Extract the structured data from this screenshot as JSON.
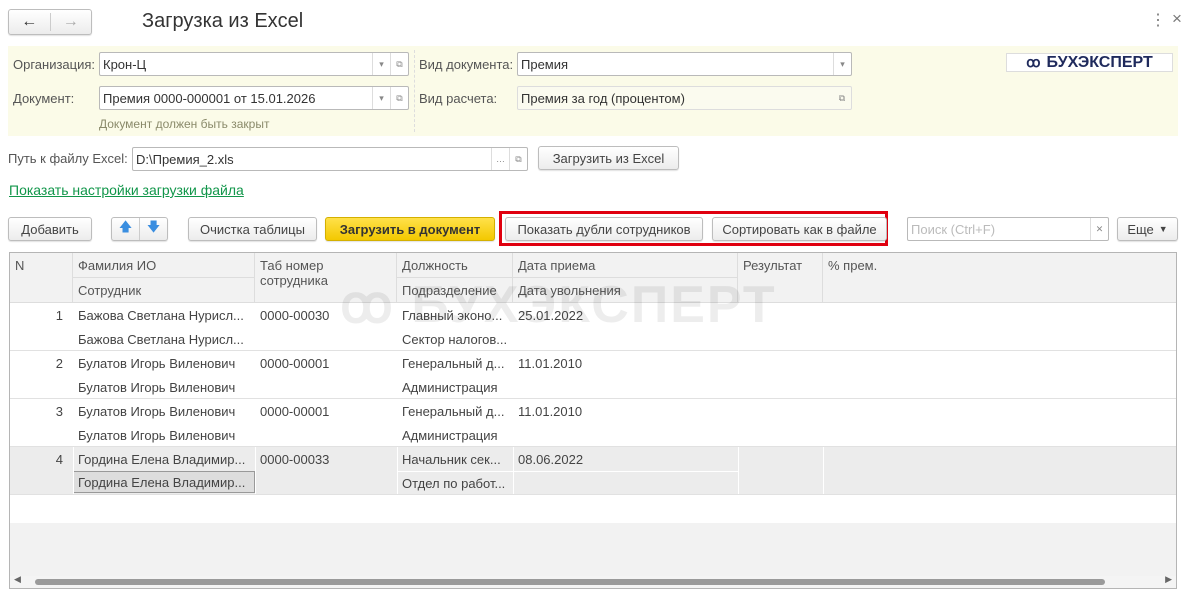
{
  "window": {
    "title": "Загрузка из Excel",
    "back": "←",
    "forward": "→",
    "more": "⋮",
    "close": "×"
  },
  "logo": "БУХЭКСПЕРТ",
  "form": {
    "org_label": "Организация:",
    "org_value": "Крон-Ц",
    "doc_label": "Документ:",
    "doc_value": "Премия 0000-000001 от 15.01.2026",
    "doc_hint": "Документ должен быть закрыт",
    "doctype_label": "Вид документа:",
    "doctype_value": "Премия",
    "calc_label": "Вид расчета:",
    "calc_value": "Премия за год (процентом)",
    "path_label": "Путь к файлу Excel:",
    "path_value": "D:\\Премия_2.xls",
    "load_excel": "Загрузить из Excel",
    "settings_link": "Показать настройки загрузки файла"
  },
  "toolbar": {
    "add": "Добавить",
    "clear": "Очистка таблицы",
    "load_doc": "Загрузить в документ",
    "show_dupes": "Показать дубли сотрудников",
    "sort_file": "Сортировать как в файле",
    "search_placeholder": "Поиск (Ctrl+F)",
    "more": "Еще"
  },
  "table": {
    "headers": {
      "n": "N",
      "fio": "Фамилия ИО",
      "employee": "Сотрудник",
      "tab": "Таб номер сотрудника",
      "position": "Должность",
      "department": "Подразделение",
      "hire": "Дата приема",
      "fire": "Дата увольнения",
      "result": "Результат",
      "pct": "% прем."
    },
    "rows": [
      {
        "n": "1",
        "fio": "Бажова Светлана Нурисл...",
        "employee": "Бажова Светлана Нурисл...",
        "tab": "0000-00030",
        "position": "Главный эконо...",
        "department": "Сектор налогов...",
        "hire": "25.01.2022"
      },
      {
        "n": "2",
        "fio": "Булатов Игорь Виленович",
        "employee": "Булатов Игорь Виленович",
        "tab": "0000-00001",
        "position": "Генеральный д...",
        "department": "Администрация",
        "hire": "11.01.2010"
      },
      {
        "n": "3",
        "fio": "Булатов Игорь Виленович",
        "employee": "Булатов Игорь Виленович",
        "tab": "0000-00001",
        "position": "Генеральный д...",
        "department": "Администрация",
        "hire": "11.01.2010"
      },
      {
        "n": "4",
        "fio": "Гордина Елена Владимир...",
        "employee": "Гордина Елена Владимир...",
        "tab": "0000-00033",
        "position": "Начальник сек...",
        "department": "Отдел по работ...",
        "hire": "08.06.2022"
      }
    ]
  }
}
